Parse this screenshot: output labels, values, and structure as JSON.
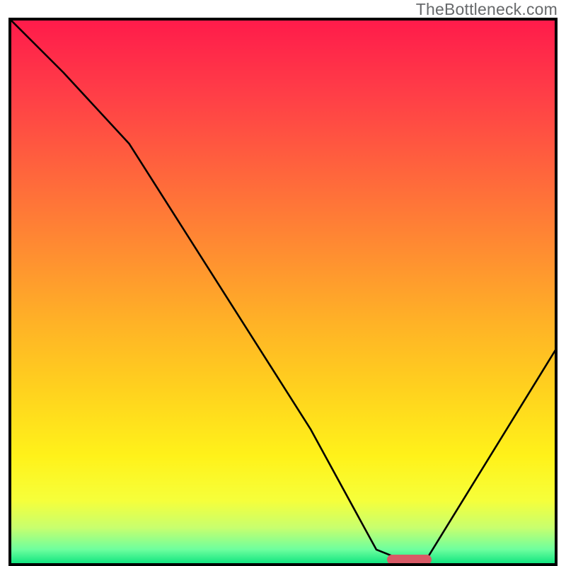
{
  "watermark": "TheBottleneck.com",
  "chart_data": {
    "type": "line",
    "title": "",
    "xlabel": "",
    "ylabel": "",
    "xlim": [
      0,
      100
    ],
    "ylim": [
      0,
      100
    ],
    "grid": false,
    "series": [
      {
        "name": "bottleneck-curve",
        "x": [
          0,
          10,
          22,
          55,
          67,
          72,
          76,
          100
        ],
        "values": [
          100,
          90,
          77,
          25,
          3,
          1,
          1,
          40
        ]
      }
    ],
    "annotations": [
      {
        "name": "flat-valley-marker",
        "type": "bar-segment",
        "x_start": 69,
        "x_end": 77,
        "y": 0,
        "color": "#d85a66"
      }
    ],
    "background": {
      "type": "vertical-gradient",
      "stops": [
        {
          "pos": 0,
          "color": "#ff1a4b"
        },
        {
          "pos": 14,
          "color": "#ff3e47"
        },
        {
          "pos": 30,
          "color": "#ff6a3b"
        },
        {
          "pos": 44,
          "color": "#ff9130"
        },
        {
          "pos": 56,
          "color": "#ffb326"
        },
        {
          "pos": 68,
          "color": "#ffd21e"
        },
        {
          "pos": 80,
          "color": "#fff21a"
        },
        {
          "pos": 88,
          "color": "#f6ff3a"
        },
        {
          "pos": 93,
          "color": "#c8ff6e"
        },
        {
          "pos": 97,
          "color": "#6dff9e"
        },
        {
          "pos": 100,
          "color": "#00e07a"
        }
      ]
    }
  }
}
